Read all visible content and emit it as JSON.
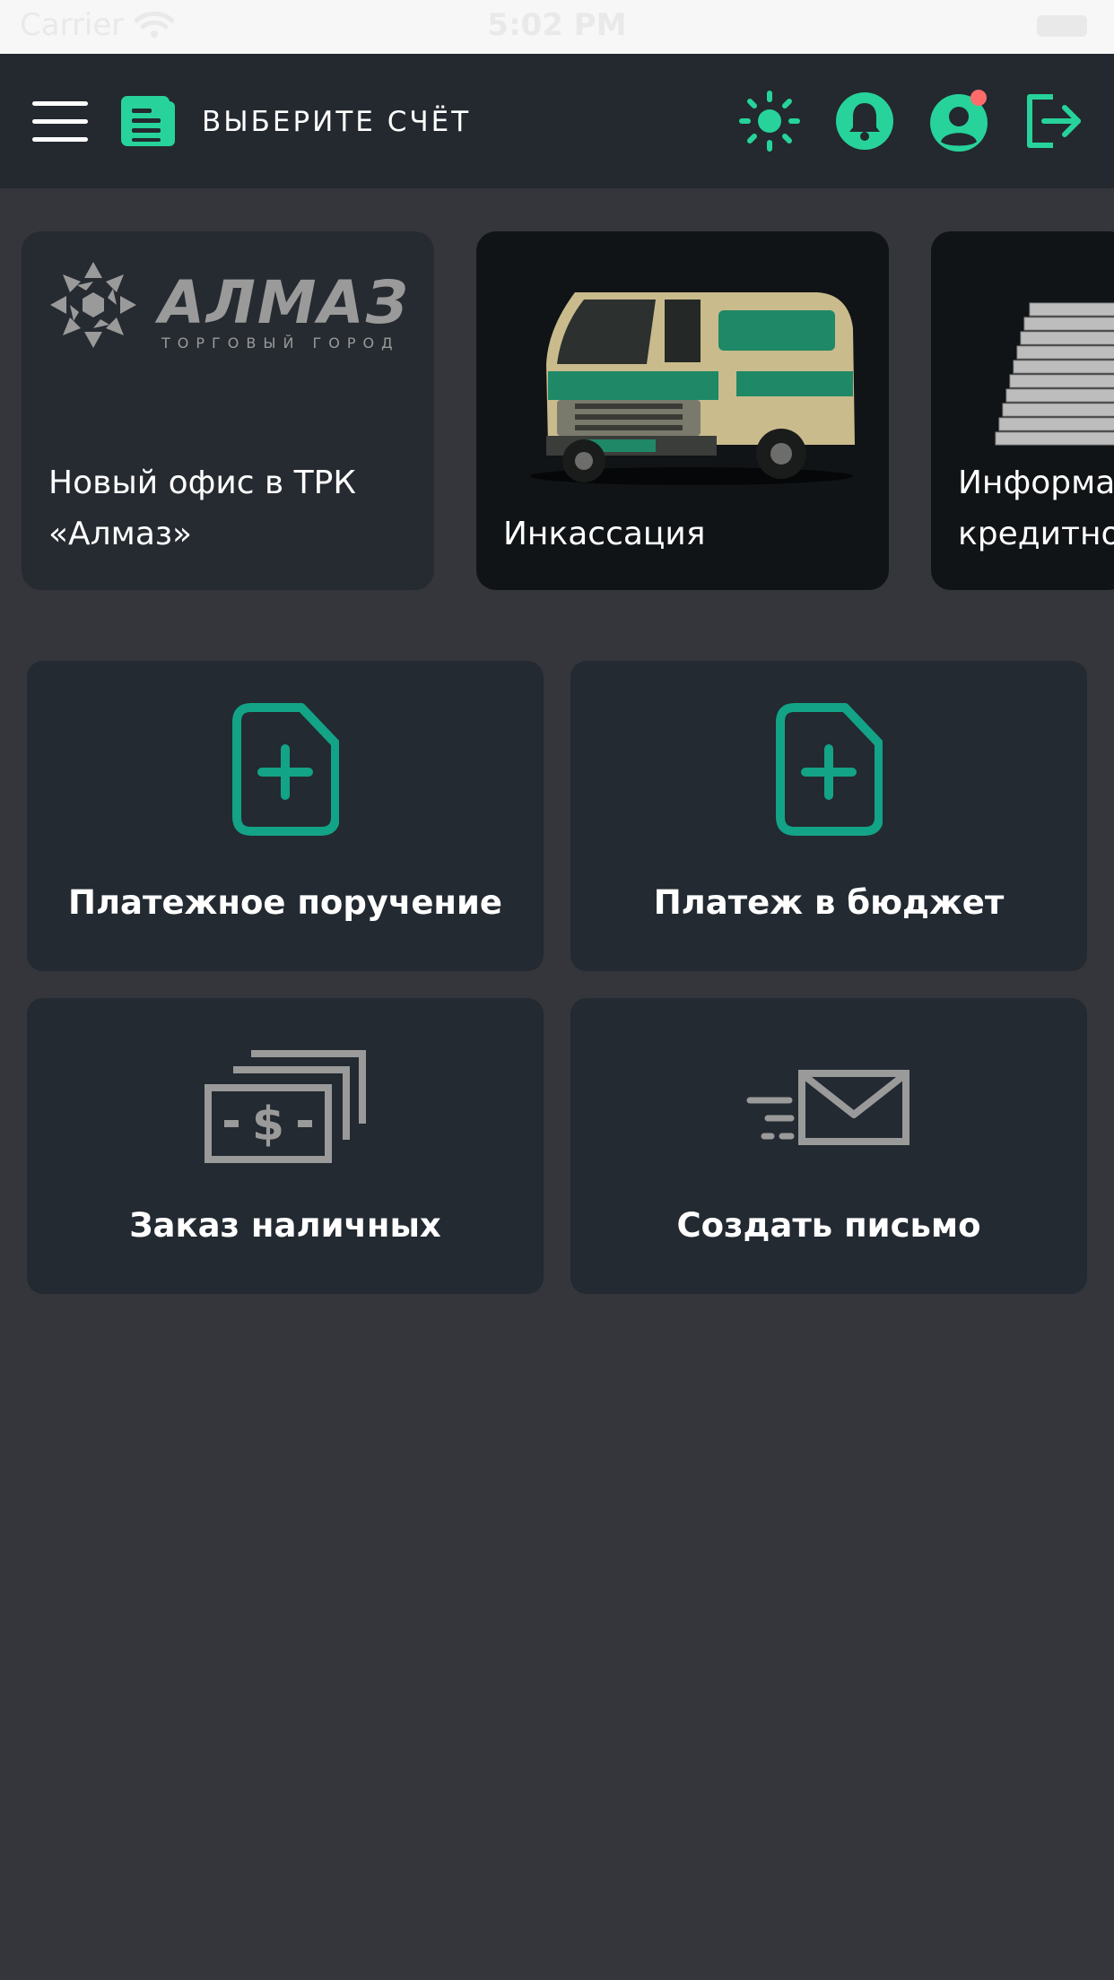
{
  "status_bar": {
    "carrier": "Carrier",
    "time": "5:02 PM"
  },
  "header": {
    "menu_icon": "hamburger-menu-icon",
    "account_icon": "document-list-icon",
    "account_label": "ВЫБЕРИТЕ СЧЁТ",
    "icons": [
      "sun-theme-icon",
      "bell-icon",
      "user-profile-icon",
      "logout-icon"
    ],
    "profile_has_notification": true,
    "colors": {
      "accent": "#27d39a",
      "header_bg": "#23292f",
      "notification_dot": "#ff6b6b"
    }
  },
  "promos": [
    {
      "logo_text": "АЛМАЗ",
      "logo_subtitle": "ТОРГОВЫЙ ГОРОД",
      "title_line1": "Новый офис в ТРК",
      "title_line2": "«Алмаз»"
    },
    {
      "title_line1": "Инкассация"
    },
    {
      "title_line1": "Информац",
      "title_line2": "кредитной"
    }
  ],
  "actions": [
    {
      "label": "Платежное поручение",
      "icon": "document-add-icon"
    },
    {
      "label": "Платеж в бюджет",
      "icon": "document-add-icon"
    },
    {
      "label": "Заказ наличных",
      "icon": "cash-stack-icon"
    },
    {
      "label": "Создать письмо",
      "icon": "send-mail-icon"
    }
  ],
  "colors": {
    "page_bg": "#34363b",
    "tile_bg": "#232a31",
    "icon_green": "#13a386",
    "icon_gray": "#9a9a9a"
  }
}
